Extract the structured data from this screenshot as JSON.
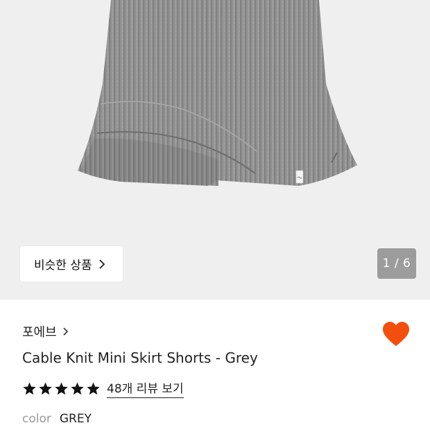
{
  "gallery": {
    "similar_button_label": "비슷한 상품",
    "page_counter": "1 / 6"
  },
  "product": {
    "brand": "포에브",
    "title": "Cable Knit Mini Skirt Shorts - Grey",
    "rating_stars": 5,
    "review_link_label": "48개 리뷰 보기",
    "color_label": "color",
    "color_value": "GREY",
    "wishlisted": true
  },
  "colors": {
    "gallery_bg": "#efefef",
    "heart": "#f24f0f",
    "counter_bg": "#9c9c9c",
    "muted_text": "#9a9a9a",
    "knit_grey": "#8d8d8d"
  },
  "icons": {
    "similar_chevron": "chevron-right-icon",
    "brand_chevron": "chevron-right-icon",
    "wishlist": "heart-icon",
    "rating": "star-icon"
  }
}
